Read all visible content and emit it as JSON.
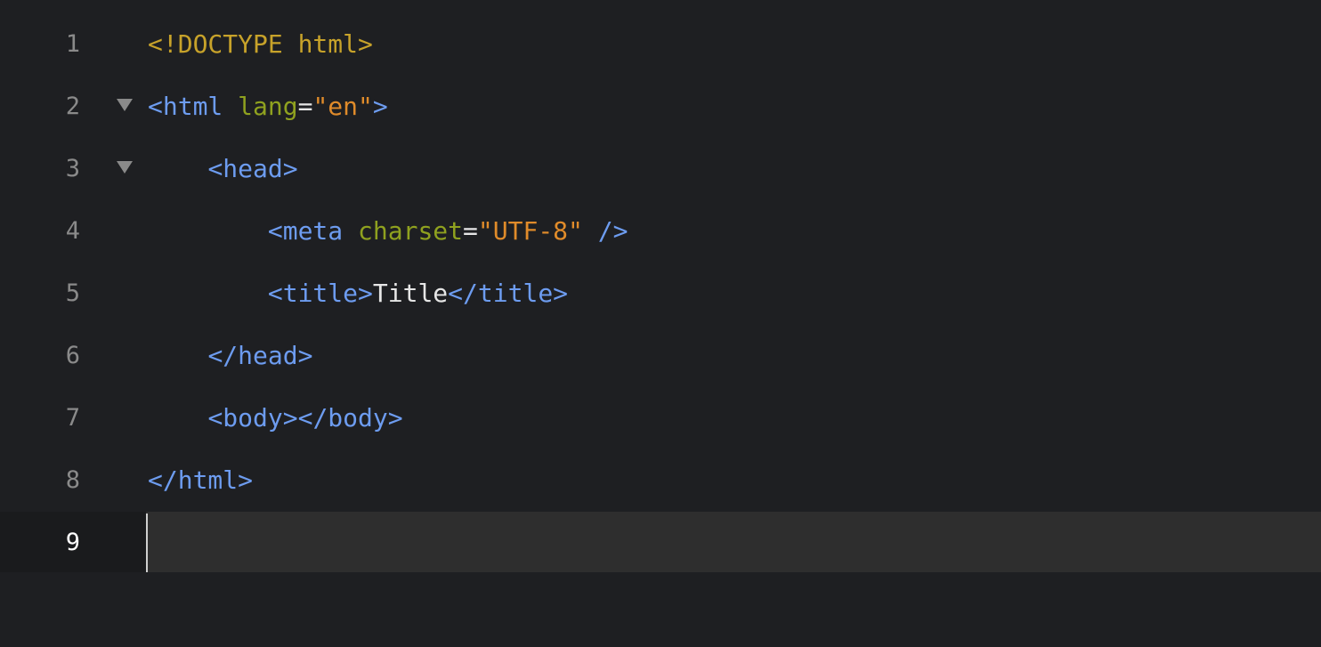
{
  "colors": {
    "background": "#1e1f22",
    "active_line": "#2e2e2e",
    "doctype": "#c7a22a",
    "tag": "#6d9cf0",
    "attribute": "#8fa11f",
    "string": "#e08b2a",
    "text": "#e6e6e6",
    "punct": "#e6e6e6",
    "line_number": "#8a8a8a"
  },
  "editor": {
    "active_line": 9,
    "lines": [
      {
        "number": "1",
        "indent": "",
        "fold": false,
        "tokens": [
          {
            "t": "<!DOCTYPE html>",
            "k": "doctype"
          }
        ]
      },
      {
        "number": "2",
        "indent": "",
        "fold": true,
        "tokens": [
          {
            "t": "<html",
            "k": "tag"
          },
          {
            "t": " ",
            "k": "text"
          },
          {
            "t": "lang",
            "k": "attribute"
          },
          {
            "t": "=",
            "k": "punct"
          },
          {
            "t": "\"en\"",
            "k": "string"
          },
          {
            "t": ">",
            "k": "tag"
          }
        ]
      },
      {
        "number": "3",
        "indent": "    ",
        "fold": true,
        "tokens": [
          {
            "t": "<head>",
            "k": "tag"
          }
        ]
      },
      {
        "number": "4",
        "indent": "        ",
        "fold": false,
        "tokens": [
          {
            "t": "<meta",
            "k": "tag"
          },
          {
            "t": " ",
            "k": "text"
          },
          {
            "t": "charset",
            "k": "attribute"
          },
          {
            "t": "=",
            "k": "punct"
          },
          {
            "t": "\"UTF-8\"",
            "k": "string"
          },
          {
            "t": " />",
            "k": "tag"
          }
        ]
      },
      {
        "number": "5",
        "indent": "        ",
        "fold": false,
        "tokens": [
          {
            "t": "<title>",
            "k": "tag"
          },
          {
            "t": "Title",
            "k": "text"
          },
          {
            "t": "</title>",
            "k": "tag"
          }
        ]
      },
      {
        "number": "6",
        "indent": "    ",
        "fold": false,
        "tokens": [
          {
            "t": "</head>",
            "k": "tag"
          }
        ]
      },
      {
        "number": "7",
        "indent": "    ",
        "fold": false,
        "tokens": [
          {
            "t": "<body>",
            "k": "tag"
          },
          {
            "t": "</body>",
            "k": "tag"
          }
        ]
      },
      {
        "number": "8",
        "indent": "",
        "fold": false,
        "tokens": [
          {
            "t": "</html>",
            "k": "tag"
          }
        ]
      },
      {
        "number": "9",
        "indent": "",
        "fold": false,
        "tokens": []
      }
    ]
  }
}
